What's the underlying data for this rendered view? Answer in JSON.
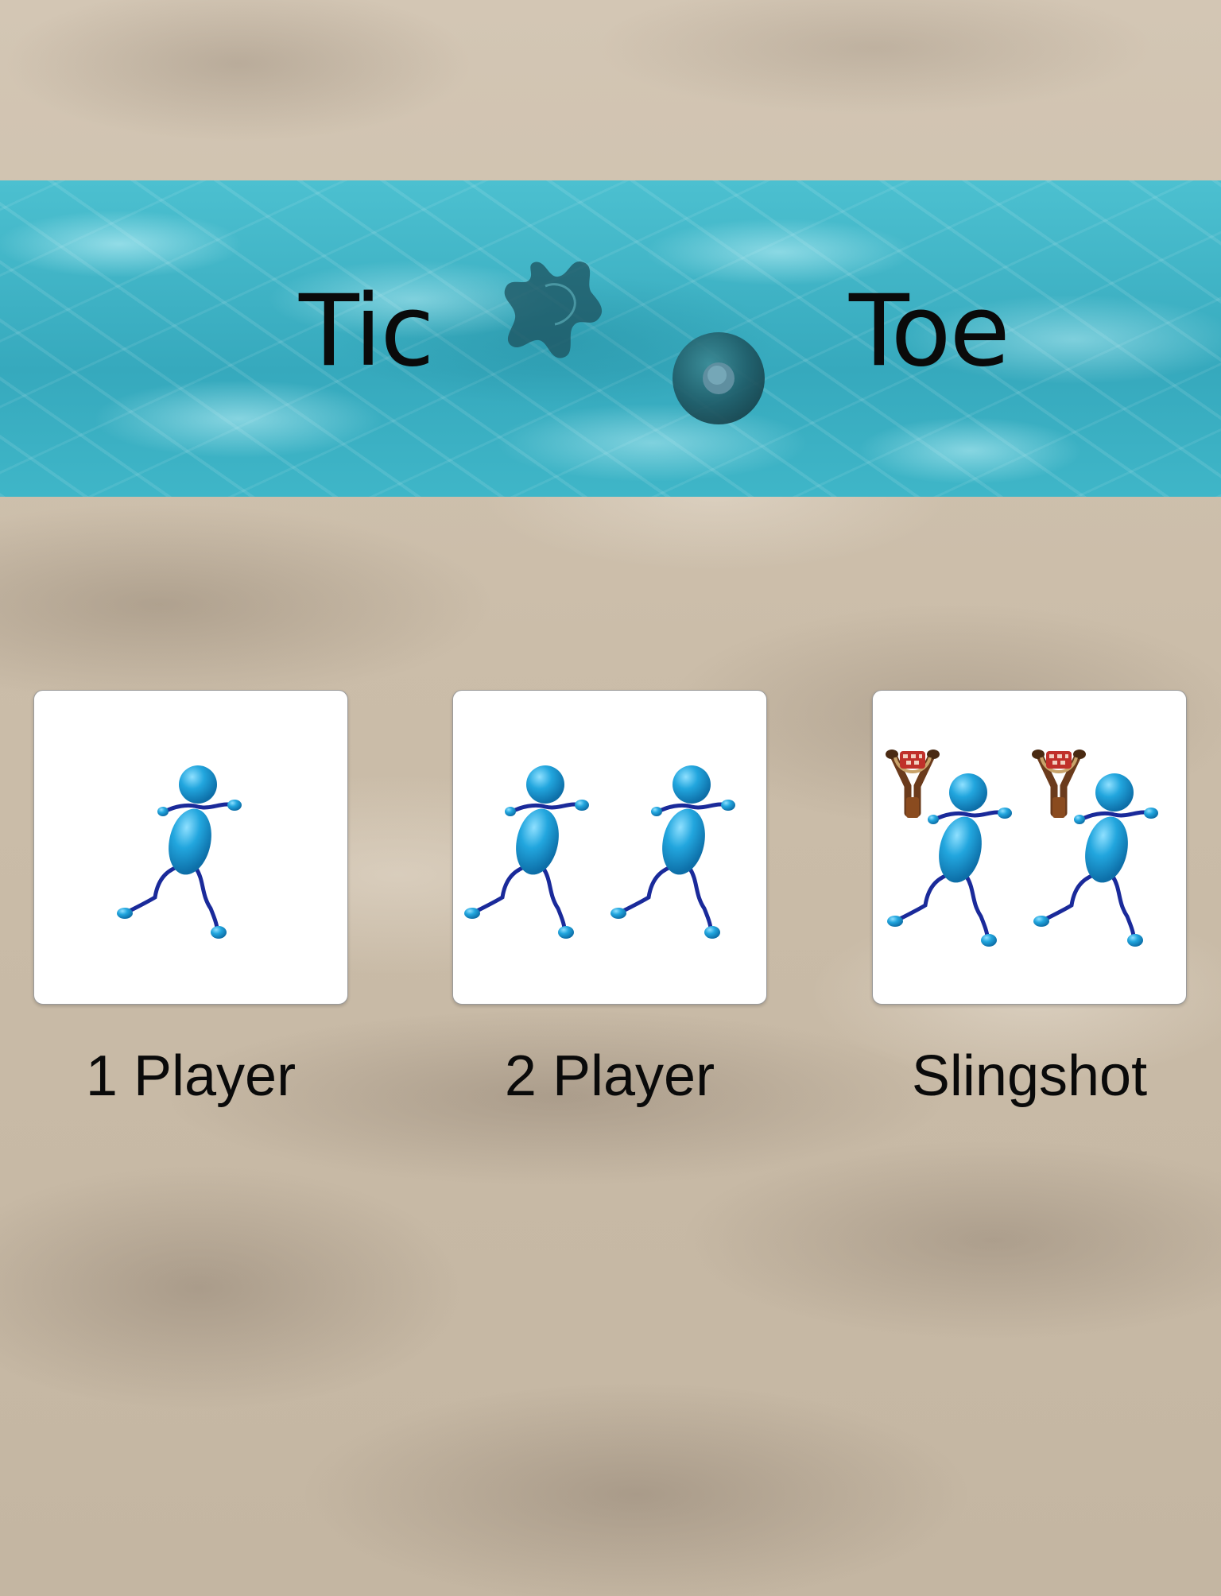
{
  "title": {
    "left_word": "Tic",
    "right_word": "Toe",
    "x_mark_icon": "splash-x-icon",
    "o_mark_icon": "ring-o-icon"
  },
  "modes": [
    {
      "label": "1 Player",
      "icon": "single-runner-icon"
    },
    {
      "label": "2 Player",
      "icon": "two-runners-icon"
    },
    {
      "label": "Slingshot",
      "icon": "slingshot-runners-icon"
    }
  ],
  "colors": {
    "water": "#3fb4c6",
    "sand": "#cfc2b0",
    "figure_body": "#1f9fd6",
    "figure_limbs": "#1a2a9a",
    "card_background": "#ffffff",
    "text": "#0a0a0a"
  }
}
